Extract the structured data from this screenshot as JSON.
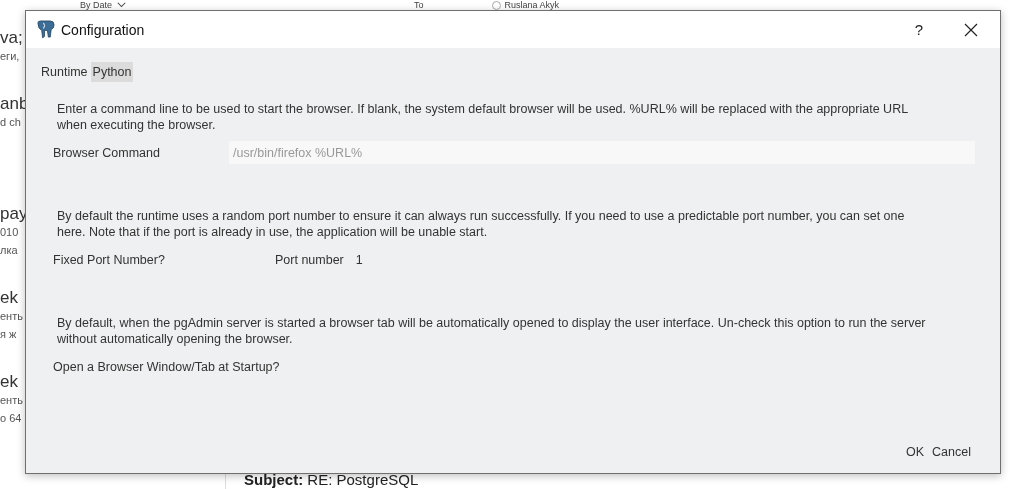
{
  "background_app": {
    "sort_label": "By Date",
    "column_to": "To",
    "recipient": {
      "name": "Ruslana Akyk",
      "selected": false
    },
    "list_fragments": [
      {
        "text": "va;",
        "kind": "title"
      },
      {
        "text": "еги,",
        "kind": "sub"
      },
      {
        "text": "anb",
        "kind": "title"
      },
      {
        "text": "d ch",
        "kind": "sub"
      },
      {
        "text": "pay",
        "kind": "title"
      },
      {
        "text": "010",
        "kind": "sub"
      },
      {
        "text": "лка",
        "kind": "sub"
      },
      {
        "text": "ek",
        "kind": "title"
      },
      {
        "text": "енть",
        "kind": "sub"
      },
      {
        "text": "я ж",
        "kind": "sub"
      },
      {
        "text": "ek",
        "kind": "title"
      },
      {
        "text": "енть",
        "kind": "sub"
      },
      {
        "text": "о 64",
        "kind": "sub"
      }
    ],
    "subject": "**Subject:** RE: PostgreSQL"
  },
  "window": {
    "title": "Configuration",
    "help": "?"
  },
  "section_label": "Runtime",
  "tabs": [
    {
      "label": "Python",
      "selected": true
    }
  ],
  "settings": [
    {
      "kind": "text",
      "description": "Enter a command line to be used to start the browser. If blank, the system default browser will be used. %URL% will be replaced with the appropriate URL when executing the browser.",
      "label": "Browser Command",
      "placeholder": "/usr/bin/firefox %URL%"
    },
    {
      "kind": "port",
      "description": "By default the runtime uses a random port number to ensure it can always run successfully. If you need to use a predictable port number, you can set one here. Note that if the port is already in use, the application will be unable start.",
      "label": "Fixed Port Number?",
      "field_label": "Port number",
      "value": "1"
    },
    {
      "kind": "check",
      "description": "By default, when the pgAdmin server is started a browser tab will be automatically opened to display the user interface. Un-check this option to run the server without automatically opening the browser.",
      "label": "Open a Browser Window/Tab at Startup?"
    }
  ],
  "buttons": [
    "OK",
    "Cancel"
  ]
}
